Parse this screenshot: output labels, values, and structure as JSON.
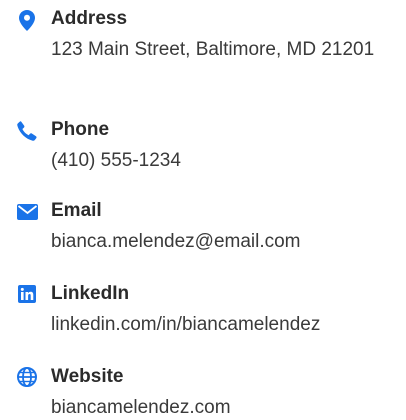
{
  "theme": {
    "accent": "#1a73e8",
    "label_color": "#2b2b2b",
    "value_color": "#3a3a3a"
  },
  "contacts": [
    {
      "icon": "map-pin-icon",
      "label": "Address",
      "value": "123 Main Street, Baltimore, MD 21201"
    },
    {
      "icon": "phone-icon",
      "label": "Phone",
      "value": "(410) 555-1234"
    },
    {
      "icon": "envelope-icon",
      "label": "Email",
      "value": "bianca.melendez@email.com"
    },
    {
      "icon": "linkedin-icon",
      "label": "LinkedIn",
      "value": "linkedin.com/in/biancamelendez"
    },
    {
      "icon": "globe-icon",
      "label": "Website",
      "value": "biancamelendez.com"
    }
  ]
}
